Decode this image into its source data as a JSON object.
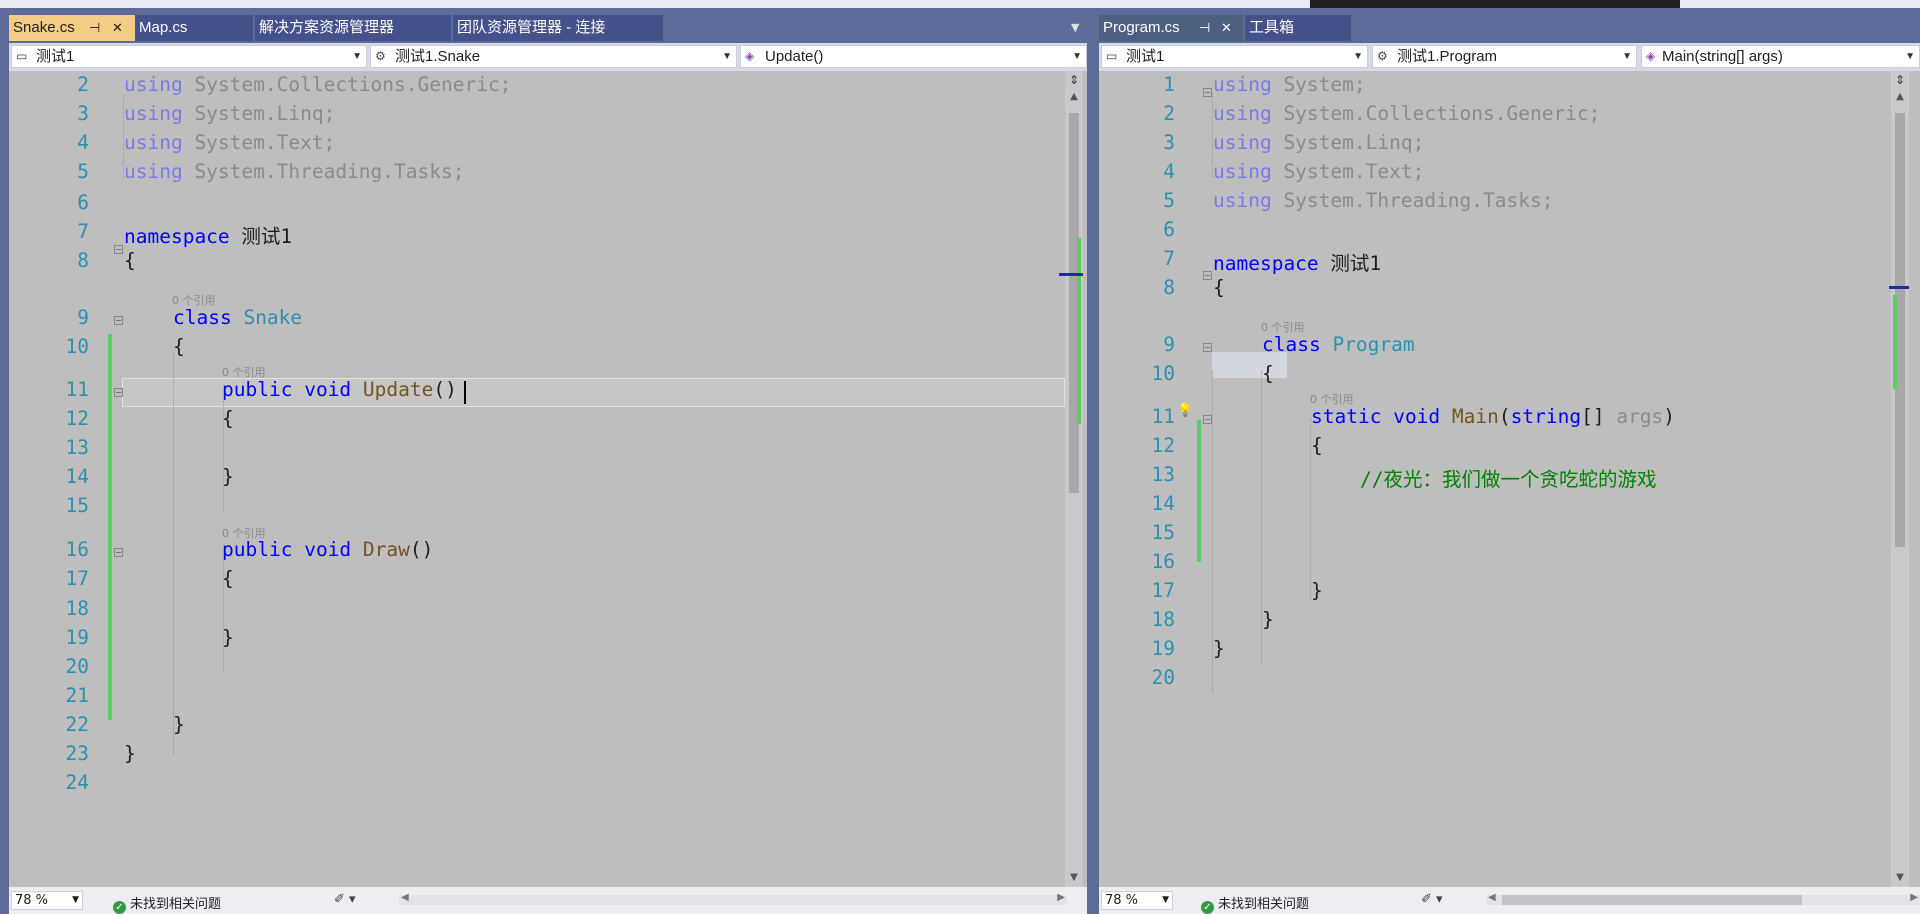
{
  "colors": {
    "keyword": "#0000ff",
    "type": "#2b91af",
    "method": "#74531f",
    "comment": "#008000",
    "line_number": "#2b91af",
    "change_bar": "#57d061",
    "active_tab": "#f5cc84"
  },
  "left": {
    "tabs": [
      {
        "label": "Snake.cs",
        "active": true
      },
      {
        "label": "Map.cs"
      },
      {
        "label": "解决方案资源管理器"
      },
      {
        "label": "团队资源管理器 - 连接"
      }
    ],
    "nav": {
      "project": "测试1",
      "class": "测试1.Snake",
      "member": "Update()"
    },
    "zoom": "78 %",
    "issues": "未找到相关问题",
    "code_lens": [
      "0 个引用",
      "0 个引用",
      "0 个引用"
    ],
    "lines": [
      {
        "n": "2",
        "text": "using System.Collections.Generic;"
      },
      {
        "n": "3",
        "text": "using System.Linq;"
      },
      {
        "n": "4",
        "text": "using System.Text;"
      },
      {
        "n": "5",
        "text": "using System.Threading.Tasks;"
      },
      {
        "n": "6",
        "text": ""
      },
      {
        "n": "7",
        "text": "namespace 测试1"
      },
      {
        "n": "8",
        "text": "{"
      },
      {
        "n": "9",
        "text": "class Snake"
      },
      {
        "n": "10",
        "text": "{"
      },
      {
        "n": "11",
        "text": "public void Update()"
      },
      {
        "n": "12",
        "text": "{"
      },
      {
        "n": "13",
        "text": ""
      },
      {
        "n": "14",
        "text": "}"
      },
      {
        "n": "15",
        "text": ""
      },
      {
        "n": "16",
        "text": "public void Draw()"
      },
      {
        "n": "17",
        "text": "{"
      },
      {
        "n": "18",
        "text": ""
      },
      {
        "n": "19",
        "text": "}"
      },
      {
        "n": "20",
        "text": ""
      },
      {
        "n": "21",
        "text": ""
      },
      {
        "n": "22",
        "text": "}"
      },
      {
        "n": "23",
        "text": "}"
      },
      {
        "n": "24",
        "text": ""
      }
    ]
  },
  "right": {
    "tabs": [
      {
        "label": "Program.cs",
        "active": true
      },
      {
        "label": "工具箱"
      }
    ],
    "nav": {
      "project": "测试1",
      "class": "测试1.Program",
      "member": "Main(string[] args)"
    },
    "zoom": "78 %",
    "issues": "未找到相关问题",
    "code_lens": [
      "0 个引用",
      "0 个引用"
    ],
    "lines": [
      {
        "n": "1",
        "text": "using System;"
      },
      {
        "n": "2",
        "text": "using System.Collections.Generic;"
      },
      {
        "n": "3",
        "text": "using System.Linq;"
      },
      {
        "n": "4",
        "text": "using System.Text;"
      },
      {
        "n": "5",
        "text": "using System.Threading.Tasks;"
      },
      {
        "n": "6",
        "text": ""
      },
      {
        "n": "7",
        "text": "namespace 测试1"
      },
      {
        "n": "8",
        "text": "{"
      },
      {
        "n": "9",
        "text": "class Program"
      },
      {
        "n": "10",
        "text": "{"
      },
      {
        "n": "11",
        "text": "static void Main(string[] args)"
      },
      {
        "n": "12",
        "text": "{"
      },
      {
        "n": "13",
        "text": "//夜光：我们做一个贪吃蛇的游戏"
      },
      {
        "n": "14",
        "text": ""
      },
      {
        "n": "15",
        "text": ""
      },
      {
        "n": "16",
        "text": ""
      },
      {
        "n": "17",
        "text": "}"
      },
      {
        "n": "18",
        "text": "}"
      },
      {
        "n": "19",
        "text": "}"
      },
      {
        "n": "20",
        "text": ""
      }
    ]
  }
}
